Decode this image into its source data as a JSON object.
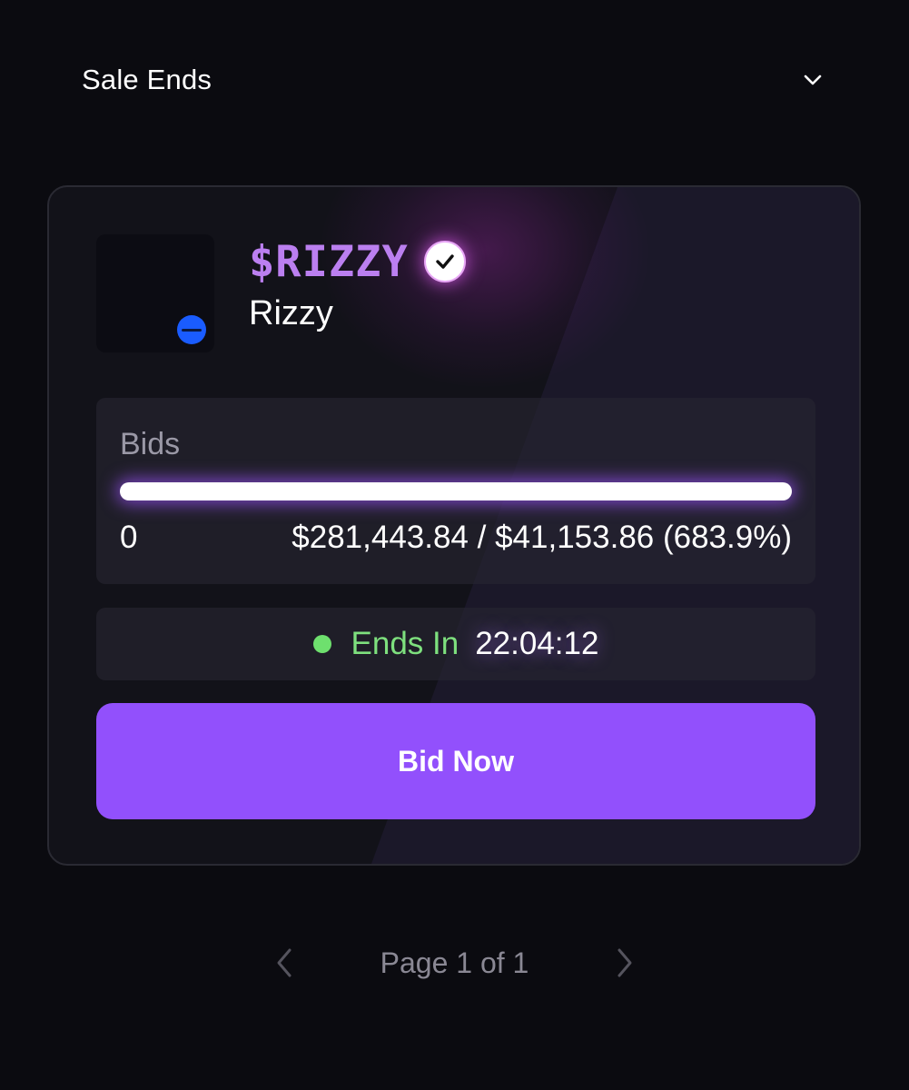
{
  "sort": {
    "label": "Sale Ends",
    "icon": "chevron-down-icon"
  },
  "token": {
    "symbol": "$RIZZY",
    "name": "Rizzy",
    "verified": true,
    "chain_icon": "chain-badge-icon",
    "symbol_color": "#bb7ff0"
  },
  "bids": {
    "label": "Bids",
    "count": "0",
    "amount": "$281,443.84 / $41,153.86 (683.9%)",
    "progress_fraction": 1.0
  },
  "timer": {
    "label": "Ends In",
    "value": "22:04:12",
    "status_color": "#6ee06e"
  },
  "actions": {
    "bid_label": "Bid Now",
    "accent": "#9250fc"
  },
  "pagination": {
    "label": "Page 1 of 1",
    "prev_icon": "chevron-left-icon",
    "next_icon": "chevron-right-icon"
  }
}
